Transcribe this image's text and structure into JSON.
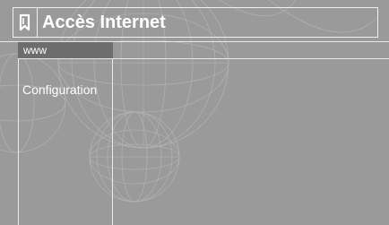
{
  "title": {
    "text": "Accès Internet",
    "icon": "bookmark-icon"
  },
  "category_tab": {
    "label": "www"
  },
  "menu": {
    "items": [
      {
        "label": "Configuration"
      }
    ]
  },
  "colors": {
    "background": "#9a9a9a",
    "tab_fill": "#6d6d6d",
    "outline": "#f0f0f0",
    "text": "#ffffff"
  }
}
